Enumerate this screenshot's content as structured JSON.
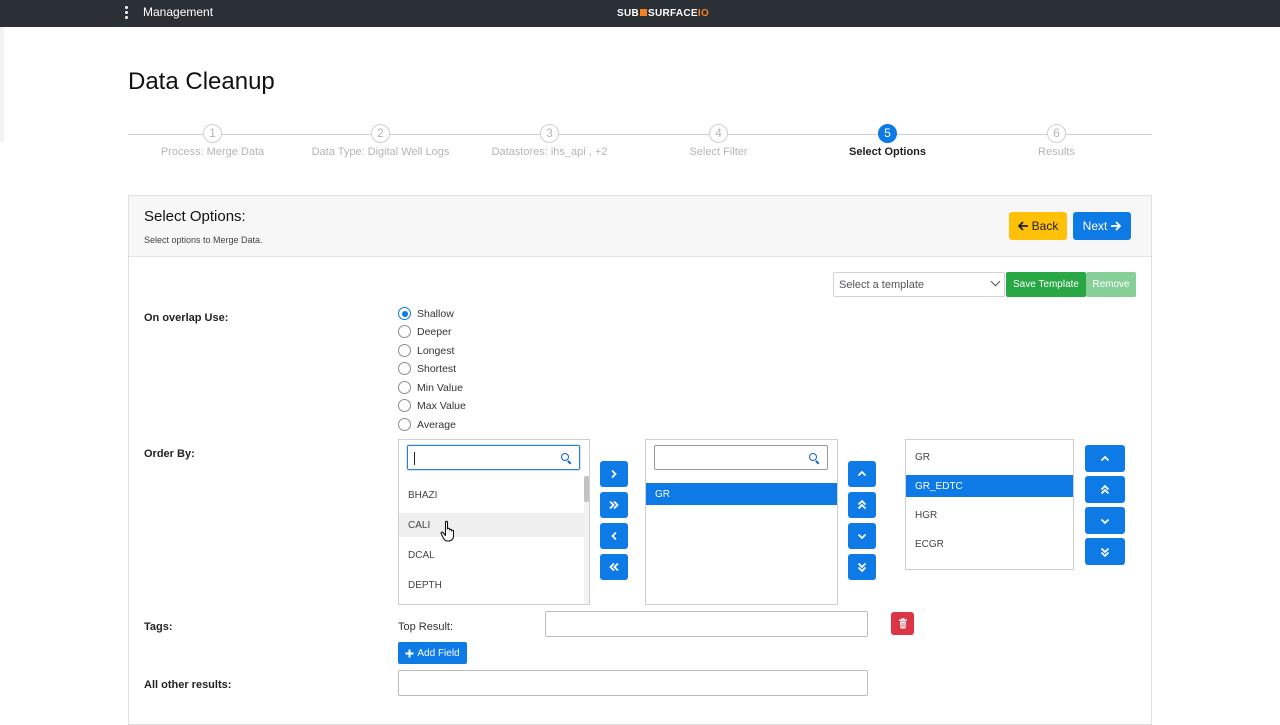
{
  "topbar": {
    "menu_label": "Management",
    "logo_left": "SUB",
    "logo_mid": "SURFACE",
    "logo_right": "IO"
  },
  "page": {
    "title": "Data Cleanup"
  },
  "stepper": {
    "steps": [
      {
        "number": "1",
        "label": "Process: Merge Data"
      },
      {
        "number": "2",
        "label": "Data Type: Digital Well Logs"
      },
      {
        "number": "3",
        "label": "Datastores: ihs_api , +2"
      },
      {
        "number": "4",
        "label": "Select Filter"
      },
      {
        "number": "5",
        "label": "Select Options"
      },
      {
        "number": "6",
        "label": "Results"
      }
    ],
    "active_step": "5"
  },
  "card": {
    "title": "Select Options:",
    "subtitle": "Select options to Merge Data.",
    "back_label": "Back",
    "next_label": "Next"
  },
  "template": {
    "placeholder": "Select a template",
    "save_label": "Save Template",
    "remove_label": "Remove"
  },
  "overlap": {
    "label": "On overlap Use:",
    "options": [
      "Shallow",
      "Deeper",
      "Longest",
      "Shortest",
      "Min Value",
      "Max Value",
      "Average"
    ],
    "selected": "Shallow"
  },
  "order_by": {
    "label": "Order By:",
    "available": {
      "search_value": "",
      "items": [
        "BHAZI",
        "CALI",
        "DCAL",
        "DEPTH"
      ],
      "hovered": "CALI"
    },
    "selected": {
      "search_value": "",
      "items": [
        "GR"
      ],
      "highlighted": "GR"
    },
    "order": {
      "items": [
        "GR",
        "GR_EDTC",
        "HGR",
        "ECGR"
      ],
      "highlighted": "GR_EDTC"
    }
  },
  "tags": {
    "label": "Tags:",
    "top_result_label": "Top Result:",
    "top_result_value": "",
    "add_field_label": "Add Field"
  },
  "all_other": {
    "label": "All other results:",
    "value": ""
  },
  "icons": {
    "kebab": "kebab-menu-icon",
    "back": "arrow-left-icon",
    "next": "arrow-right-icon",
    "search": "search-icon",
    "trash": "trash-icon",
    "plus": "plus-icon",
    "cursor": "hand-pointer-icon"
  },
  "colors": {
    "primary": "#0d7ae6",
    "warning": "#ffc107",
    "success": "#28a745",
    "danger": "#dc3545",
    "topbar": "#2b2f36",
    "logo_accent": "#f5821f"
  }
}
